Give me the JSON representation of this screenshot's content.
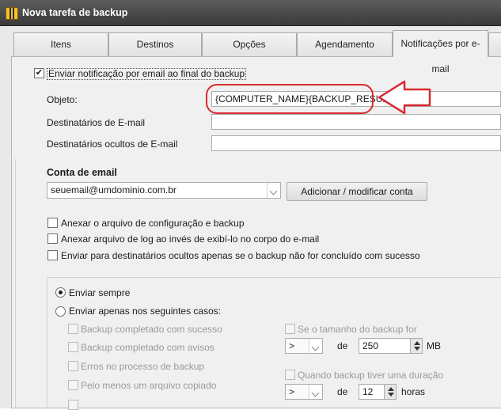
{
  "window": {
    "title": "Nova tarefa de backup"
  },
  "tabs": [
    {
      "label": "Itens"
    },
    {
      "label": "Destinos"
    },
    {
      "label": "Opções"
    },
    {
      "label": "Agendamento"
    },
    {
      "label": "Notificações por e-mail",
      "active": true
    }
  ],
  "notify": {
    "label": "Enviar notificação por email ao final do backup",
    "checked": true
  },
  "fields": {
    "subject_label": "Objeto:",
    "subject_value": "{COMPUTER_NAME}{BACKUP_RESULT}",
    "recipients_label": "Destinatários de E-mail",
    "recipients_value": "",
    "bcc_label": "Destinatários ocultos de E-mail",
    "bcc_value": ""
  },
  "account": {
    "heading": "Conta de email",
    "selected": "seuemail@umdominio.com.br",
    "add_button": "Adicionar / modificar conta"
  },
  "options": [
    {
      "label": "Anexar o arquivo de configuração e backup",
      "checked": false
    },
    {
      "label": "Anexar arquivo de log ao invés de exibí-lo no corpo do e-mail",
      "checked": false
    },
    {
      "label": "Enviar para destinatários ocultos apenas se o backup não for concluído com sucesso",
      "checked": false
    }
  ],
  "send_mode": {
    "always_label": "Enviar sempre",
    "always_selected": true,
    "cases_label": "Enviar apenas nos seguintes casos:"
  },
  "cases": [
    {
      "label": "Backup completado com sucesso"
    },
    {
      "label": "Backup completado com avisos"
    },
    {
      "label": "Erros no processo de backup"
    },
    {
      "label": "Pelo menos um arquivo copiado"
    }
  ],
  "size_condition": {
    "label": "Se o tamanho do backup for",
    "operator": ">",
    "de_label": "de",
    "value": "250",
    "unit": "MB"
  },
  "duration_condition": {
    "label": "Quando backup tiver uma duração",
    "operator": ">",
    "de_label": "de",
    "value": "12",
    "unit": "horas"
  },
  "annotation": {
    "color": "#d9292f"
  }
}
